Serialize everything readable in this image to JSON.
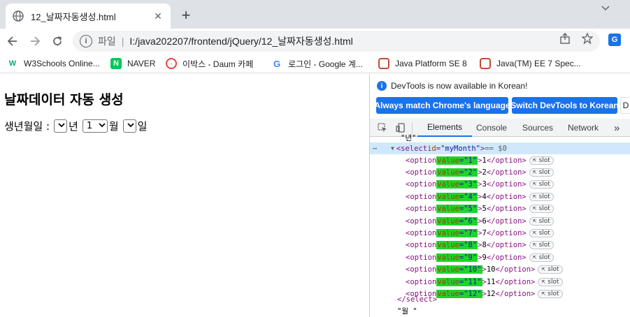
{
  "browser": {
    "tab_title": "12_날짜자동생성.html",
    "new_tab_symbol": "+",
    "url_scheme_label": "파일",
    "url": "I:/java202207/frontend/jQuery/12_날짜자동생성.html"
  },
  "bookmarks": [
    {
      "label": "W3Schools Online...",
      "icon": "w3schools-icon",
      "color": "#04aa6d"
    },
    {
      "label": "NAVER",
      "icon": "naver-icon",
      "color": "#03c75a"
    },
    {
      "label": "이박스 - Daum 카페",
      "icon": "daum-icon",
      "color": "#e8453c"
    },
    {
      "label": "로그인 - Google 계...",
      "icon": "google-icon",
      "color": "#4285f4"
    },
    {
      "label": "Java Platform SE 8",
      "icon": "oracle-icon",
      "color": "#c74634"
    },
    {
      "label": "Java(TM) EE 7 Spec...",
      "icon": "oracle-icon",
      "color": "#c74634"
    }
  ],
  "page": {
    "heading": "날짜데이터 자동 생성",
    "birth_label": "생년월일 :",
    "year_value": "",
    "year_suffix": "년",
    "month_value": "1",
    "month_suffix": "월",
    "day_value": "",
    "day_suffix": "일"
  },
  "devtools": {
    "notice": "DevTools is now available in Korean!",
    "btn_match": "Always match Chrome's language",
    "btn_switch": "Switch DevTools to Korean",
    "btn_dont": "D",
    "tabs": [
      "Elements",
      "Console",
      "Sources",
      "Network"
    ],
    "more": "»",
    "select_line": {
      "open": "<select ",
      "attr": "id",
      "value": "\"myMonth\"",
      "close": ">",
      "eq": " == $0"
    },
    "options": [
      {
        "v": "1",
        "t": "1"
      },
      {
        "v": "2",
        "t": "2"
      },
      {
        "v": "3",
        "t": "3"
      },
      {
        "v": "4",
        "t": "4"
      },
      {
        "v": "5",
        "t": "5"
      },
      {
        "v": "6",
        "t": "6"
      },
      {
        "v": "7",
        "t": "7"
      },
      {
        "v": "8",
        "t": "8"
      },
      {
        "v": "9",
        "t": "9"
      },
      {
        "v": "10",
        "t": "10"
      },
      {
        "v": "11",
        "t": "11"
      },
      {
        "v": "12",
        "t": "12"
      }
    ],
    "slot_label": "slot",
    "close_select": "</select>",
    "trailing_text": "\"월 \"",
    "top_fragment": "\"년\""
  },
  "colors": {
    "accent": "#1a73e8",
    "highlight": "#1fd42a"
  }
}
